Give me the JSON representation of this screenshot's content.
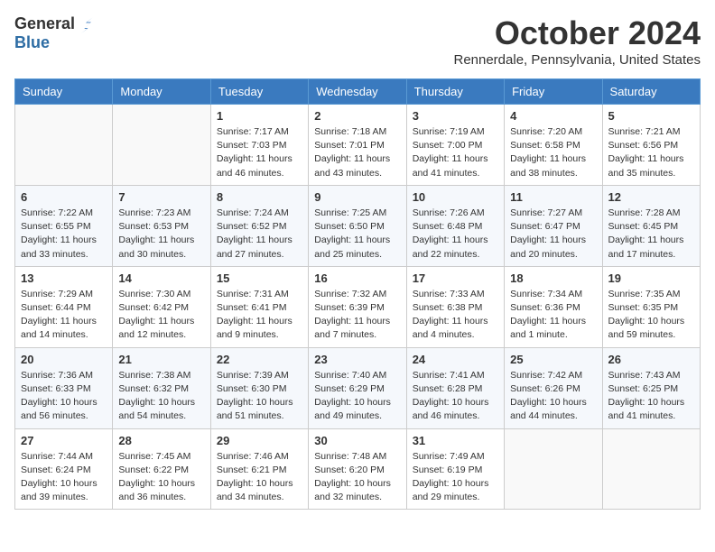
{
  "header": {
    "logo_general": "General",
    "logo_blue": "Blue",
    "month_title": "October 2024",
    "location": "Rennerdale, Pennsylvania, United States"
  },
  "weekdays": [
    "Sunday",
    "Monday",
    "Tuesday",
    "Wednesday",
    "Thursday",
    "Friday",
    "Saturday"
  ],
  "weeks": [
    [
      {
        "day": "",
        "sunrise": "",
        "sunset": "",
        "daylight": ""
      },
      {
        "day": "",
        "sunrise": "",
        "sunset": "",
        "daylight": ""
      },
      {
        "day": "1",
        "sunrise": "Sunrise: 7:17 AM",
        "sunset": "Sunset: 7:03 PM",
        "daylight": "Daylight: 11 hours and 46 minutes."
      },
      {
        "day": "2",
        "sunrise": "Sunrise: 7:18 AM",
        "sunset": "Sunset: 7:01 PM",
        "daylight": "Daylight: 11 hours and 43 minutes."
      },
      {
        "day": "3",
        "sunrise": "Sunrise: 7:19 AM",
        "sunset": "Sunset: 7:00 PM",
        "daylight": "Daylight: 11 hours and 41 minutes."
      },
      {
        "day": "4",
        "sunrise": "Sunrise: 7:20 AM",
        "sunset": "Sunset: 6:58 PM",
        "daylight": "Daylight: 11 hours and 38 minutes."
      },
      {
        "day": "5",
        "sunrise": "Sunrise: 7:21 AM",
        "sunset": "Sunset: 6:56 PM",
        "daylight": "Daylight: 11 hours and 35 minutes."
      }
    ],
    [
      {
        "day": "6",
        "sunrise": "Sunrise: 7:22 AM",
        "sunset": "Sunset: 6:55 PM",
        "daylight": "Daylight: 11 hours and 33 minutes."
      },
      {
        "day": "7",
        "sunrise": "Sunrise: 7:23 AM",
        "sunset": "Sunset: 6:53 PM",
        "daylight": "Daylight: 11 hours and 30 minutes."
      },
      {
        "day": "8",
        "sunrise": "Sunrise: 7:24 AM",
        "sunset": "Sunset: 6:52 PM",
        "daylight": "Daylight: 11 hours and 27 minutes."
      },
      {
        "day": "9",
        "sunrise": "Sunrise: 7:25 AM",
        "sunset": "Sunset: 6:50 PM",
        "daylight": "Daylight: 11 hours and 25 minutes."
      },
      {
        "day": "10",
        "sunrise": "Sunrise: 7:26 AM",
        "sunset": "Sunset: 6:48 PM",
        "daylight": "Daylight: 11 hours and 22 minutes."
      },
      {
        "day": "11",
        "sunrise": "Sunrise: 7:27 AM",
        "sunset": "Sunset: 6:47 PM",
        "daylight": "Daylight: 11 hours and 20 minutes."
      },
      {
        "day": "12",
        "sunrise": "Sunrise: 7:28 AM",
        "sunset": "Sunset: 6:45 PM",
        "daylight": "Daylight: 11 hours and 17 minutes."
      }
    ],
    [
      {
        "day": "13",
        "sunrise": "Sunrise: 7:29 AM",
        "sunset": "Sunset: 6:44 PM",
        "daylight": "Daylight: 11 hours and 14 minutes."
      },
      {
        "day": "14",
        "sunrise": "Sunrise: 7:30 AM",
        "sunset": "Sunset: 6:42 PM",
        "daylight": "Daylight: 11 hours and 12 minutes."
      },
      {
        "day": "15",
        "sunrise": "Sunrise: 7:31 AM",
        "sunset": "Sunset: 6:41 PM",
        "daylight": "Daylight: 11 hours and 9 minutes."
      },
      {
        "day": "16",
        "sunrise": "Sunrise: 7:32 AM",
        "sunset": "Sunset: 6:39 PM",
        "daylight": "Daylight: 11 hours and 7 minutes."
      },
      {
        "day": "17",
        "sunrise": "Sunrise: 7:33 AM",
        "sunset": "Sunset: 6:38 PM",
        "daylight": "Daylight: 11 hours and 4 minutes."
      },
      {
        "day": "18",
        "sunrise": "Sunrise: 7:34 AM",
        "sunset": "Sunset: 6:36 PM",
        "daylight": "Daylight: 11 hours and 1 minute."
      },
      {
        "day": "19",
        "sunrise": "Sunrise: 7:35 AM",
        "sunset": "Sunset: 6:35 PM",
        "daylight": "Daylight: 10 hours and 59 minutes."
      }
    ],
    [
      {
        "day": "20",
        "sunrise": "Sunrise: 7:36 AM",
        "sunset": "Sunset: 6:33 PM",
        "daylight": "Daylight: 10 hours and 56 minutes."
      },
      {
        "day": "21",
        "sunrise": "Sunrise: 7:38 AM",
        "sunset": "Sunset: 6:32 PM",
        "daylight": "Daylight: 10 hours and 54 minutes."
      },
      {
        "day": "22",
        "sunrise": "Sunrise: 7:39 AM",
        "sunset": "Sunset: 6:30 PM",
        "daylight": "Daylight: 10 hours and 51 minutes."
      },
      {
        "day": "23",
        "sunrise": "Sunrise: 7:40 AM",
        "sunset": "Sunset: 6:29 PM",
        "daylight": "Daylight: 10 hours and 49 minutes."
      },
      {
        "day": "24",
        "sunrise": "Sunrise: 7:41 AM",
        "sunset": "Sunset: 6:28 PM",
        "daylight": "Daylight: 10 hours and 46 minutes."
      },
      {
        "day": "25",
        "sunrise": "Sunrise: 7:42 AM",
        "sunset": "Sunset: 6:26 PM",
        "daylight": "Daylight: 10 hours and 44 minutes."
      },
      {
        "day": "26",
        "sunrise": "Sunrise: 7:43 AM",
        "sunset": "Sunset: 6:25 PM",
        "daylight": "Daylight: 10 hours and 41 minutes."
      }
    ],
    [
      {
        "day": "27",
        "sunrise": "Sunrise: 7:44 AM",
        "sunset": "Sunset: 6:24 PM",
        "daylight": "Daylight: 10 hours and 39 minutes."
      },
      {
        "day": "28",
        "sunrise": "Sunrise: 7:45 AM",
        "sunset": "Sunset: 6:22 PM",
        "daylight": "Daylight: 10 hours and 36 minutes."
      },
      {
        "day": "29",
        "sunrise": "Sunrise: 7:46 AM",
        "sunset": "Sunset: 6:21 PM",
        "daylight": "Daylight: 10 hours and 34 minutes."
      },
      {
        "day": "30",
        "sunrise": "Sunrise: 7:48 AM",
        "sunset": "Sunset: 6:20 PM",
        "daylight": "Daylight: 10 hours and 32 minutes."
      },
      {
        "day": "31",
        "sunrise": "Sunrise: 7:49 AM",
        "sunset": "Sunset: 6:19 PM",
        "daylight": "Daylight: 10 hours and 29 minutes."
      },
      {
        "day": "",
        "sunrise": "",
        "sunset": "",
        "daylight": ""
      },
      {
        "day": "",
        "sunrise": "",
        "sunset": "",
        "daylight": ""
      }
    ]
  ]
}
